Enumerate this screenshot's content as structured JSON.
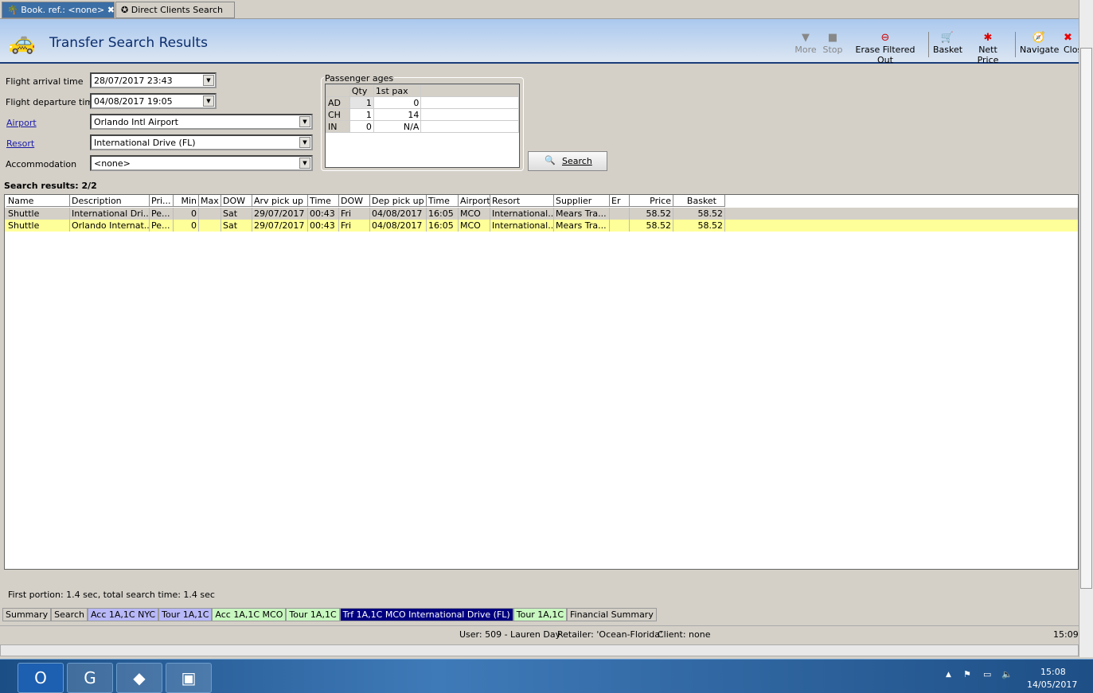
{
  "doc_tabs": [
    {
      "label": "Book. ref.: <none>"
    },
    {
      "label": "Direct Clients Search"
    }
  ],
  "header": {
    "title": "Transfer Search Results"
  },
  "toolbar": [
    {
      "label": "More",
      "icon": "triangle-down-icon",
      "enabled": false
    },
    {
      "label": "Stop",
      "icon": "stop-icon",
      "enabled": false
    },
    {
      "label": "Erase Filtered Out",
      "icon": "erase-icon",
      "enabled": true
    },
    {
      "label": "Basket",
      "icon": "basket-icon",
      "enabled": true
    },
    {
      "label": "Nett Price",
      "icon": "nett-price-icon",
      "enabled": true
    },
    {
      "label": "Navigate",
      "icon": "navigate-icon",
      "enabled": true
    },
    {
      "label": "Clos",
      "icon": "close-icon",
      "enabled": true
    }
  ],
  "form": {
    "arrival_label": "Flight arrival time",
    "arrival_value": "28/07/2017 23:43",
    "departure_label": "Flight departure time",
    "departure_value": "04/08/2017 19:05",
    "airport_label": "Airport",
    "airport_value": "Orlando Intl Airport",
    "resort_label": "Resort",
    "resort_value": "International Drive (FL)",
    "accommodation_label": "Accommodation",
    "accommodation_value": "<none>"
  },
  "passenger_ages": {
    "title": "Passenger ages",
    "headers": [
      "",
      "Qty",
      "1st pax"
    ],
    "rows": [
      [
        "AD",
        "1",
        "0"
      ],
      [
        "CH",
        "1",
        "14"
      ],
      [
        "IN",
        "0",
        "N/A"
      ]
    ]
  },
  "search_button": "Search",
  "results": {
    "summary": "Search results: 2/2",
    "columns": [
      "Name",
      "Description",
      "Pri...",
      "Min",
      "Max",
      "DOW",
      "Arv pick up",
      "Time",
      "DOW",
      "Dep pick up",
      "Time",
      "Airport",
      "Resort",
      "Supplier",
      "Er",
      "Price",
      "Basket"
    ],
    "rows": [
      [
        "Shuttle",
        "International Dri...",
        "Pe...",
        "0",
        "",
        "Sat",
        "29/07/2017",
        "00:43",
        "Fri",
        "04/08/2017",
        "16:05",
        "MCO",
        "International...",
        "Mears Tra...",
        "",
        "58.52",
        "58.52"
      ],
      [
        "Shuttle",
        "Orlando Internat...",
        "Pe...",
        "0",
        "",
        "Sat",
        "29/07/2017",
        "00:43",
        "Fri",
        "04/08/2017",
        "16:05",
        "MCO",
        "International...",
        "Mears Tra...",
        "",
        "58.52",
        "58.52"
      ]
    ]
  },
  "timing": "First portion: 1.4 sec, total search time: 1.4 sec",
  "bottom_tabs": [
    {
      "label": "Summary",
      "color": "#d4d0c8"
    },
    {
      "label": "Search",
      "color": "#d4d0c8"
    },
    {
      "label": "Acc 1A,1C NYC",
      "color": "#b8b8f8"
    },
    {
      "label": "Tour 1A,1C",
      "color": "#b8b8f8"
    },
    {
      "label": "Acc 1A,1C MCO",
      "color": "#c8f8c0"
    },
    {
      "label": "Tour 1A,1C",
      "color": "#c8f8c0"
    },
    {
      "label": "Trf 1A,1C MCO International Drive (FL)",
      "color": "#000080"
    },
    {
      "label": "Tour 1A,1C",
      "color": "#c8f8c0"
    },
    {
      "label": "Financial Summary",
      "color": "#d4d0c8"
    }
  ],
  "status": {
    "user": "User: 509 - Lauren Day",
    "retailer": "Retailer: 'Ocean-Florida'",
    "client": "Client: none",
    "time": "15:09"
  },
  "taskbar": {
    "time": "15:08",
    "date": "14/05/2017"
  }
}
